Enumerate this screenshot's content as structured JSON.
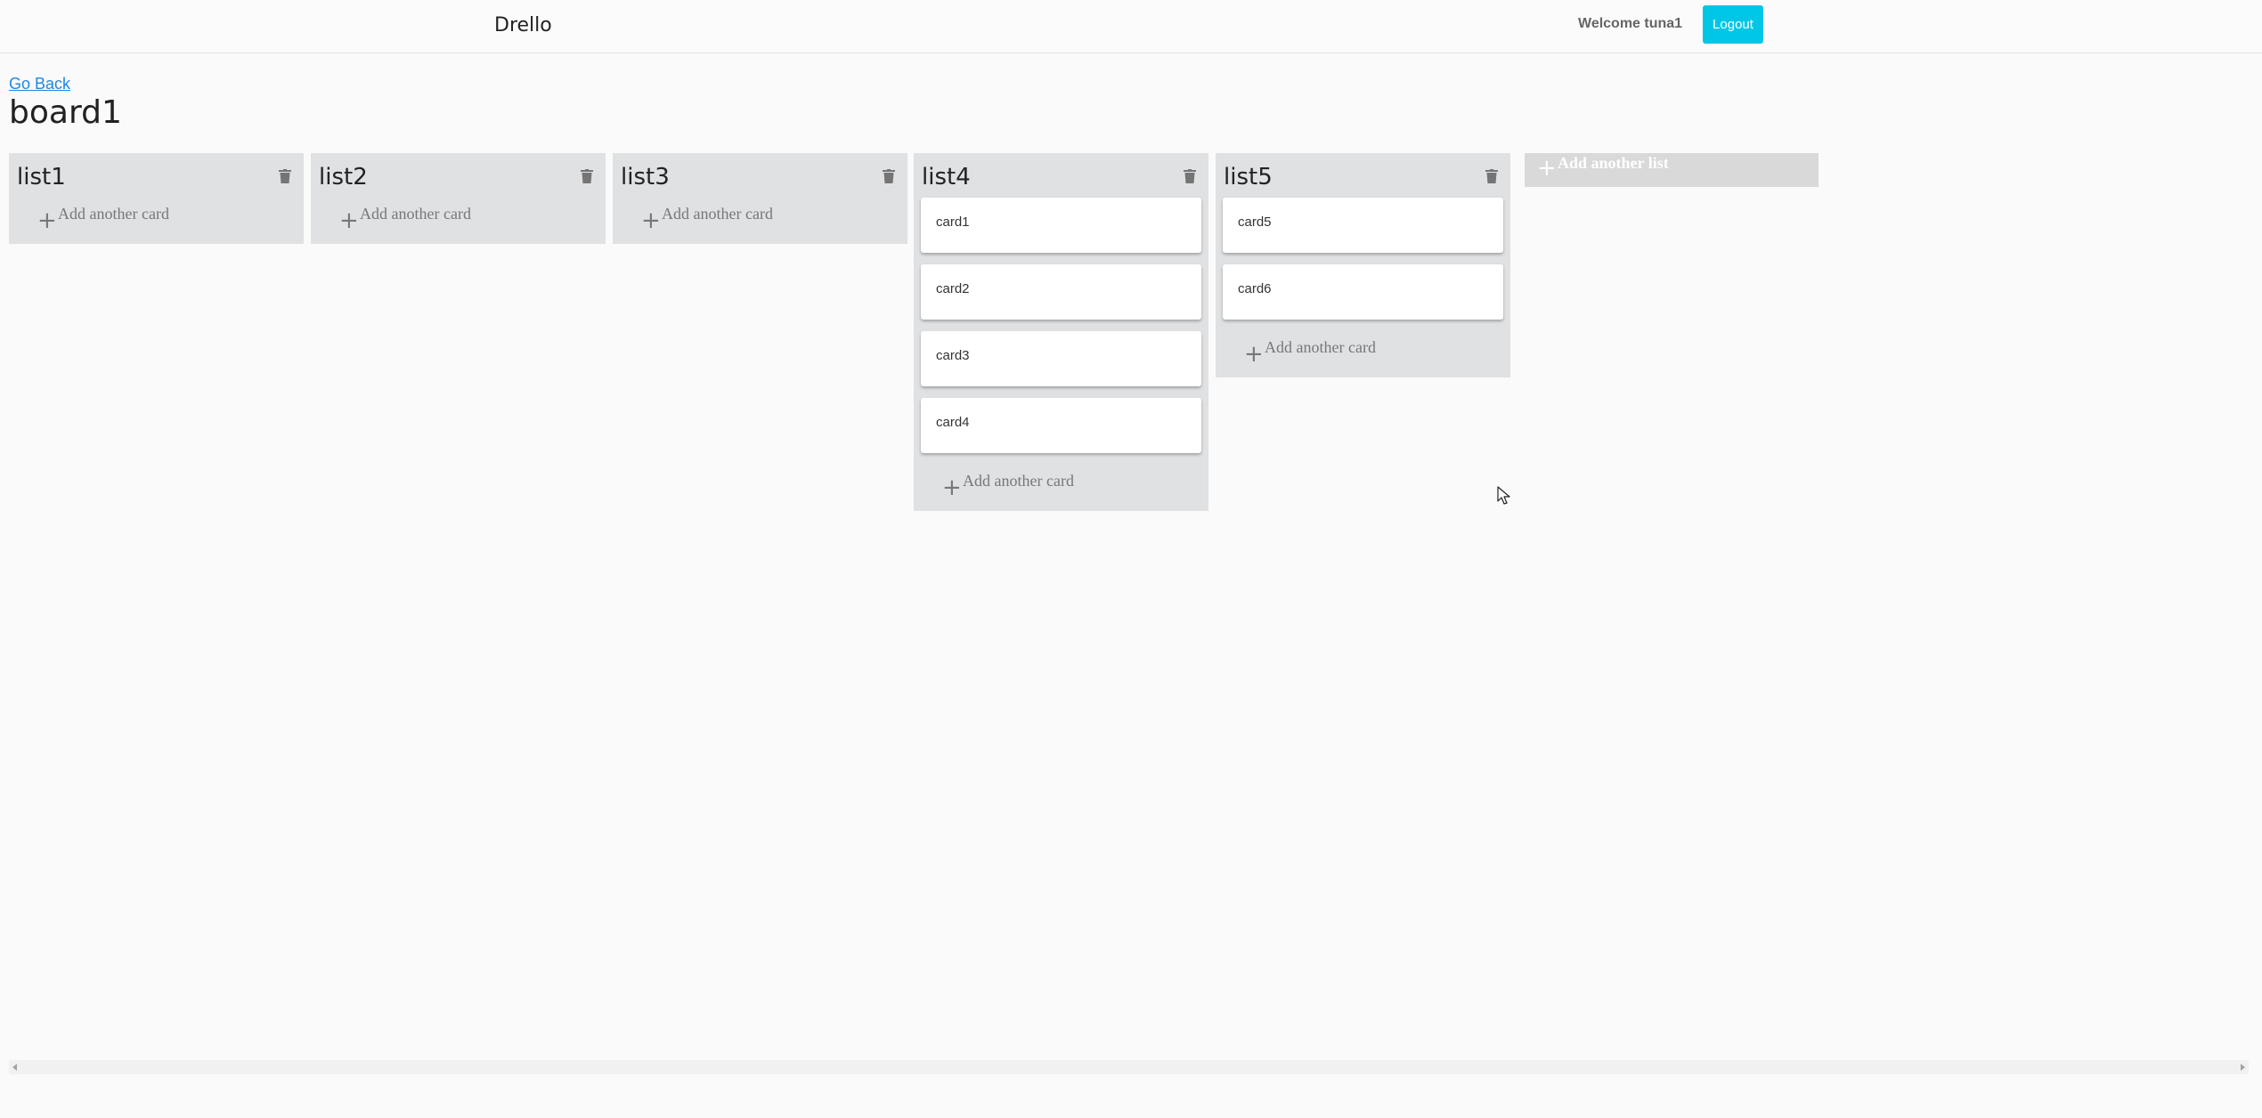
{
  "navbar": {
    "brand": "Drello",
    "welcome": "Welcome tuna1",
    "logout_label": "Logout"
  },
  "page": {
    "go_back": "Go Back",
    "board_title": "board1"
  },
  "lists": [
    {
      "title": "list1",
      "cards": [],
      "add_card_label": "Add another card"
    },
    {
      "title": "list2",
      "cards": [],
      "add_card_label": "Add another card"
    },
    {
      "title": "list3",
      "cards": [],
      "add_card_label": "Add another card"
    },
    {
      "title": "list4",
      "cards": [
        "card1",
        "card2",
        "card3",
        "card4"
      ],
      "add_card_label": "Add another card"
    },
    {
      "title": "list5",
      "cards": [
        "card5",
        "card6"
      ],
      "add_card_label": "Add another card"
    }
  ],
  "add_list_label": "Add another list",
  "icons": {
    "delete": "trash-icon",
    "add": "plus-icon"
  },
  "colors": {
    "accent": "#00c6e6",
    "link": "#1e88e5",
    "list_bg": "#dfe1e3"
  }
}
